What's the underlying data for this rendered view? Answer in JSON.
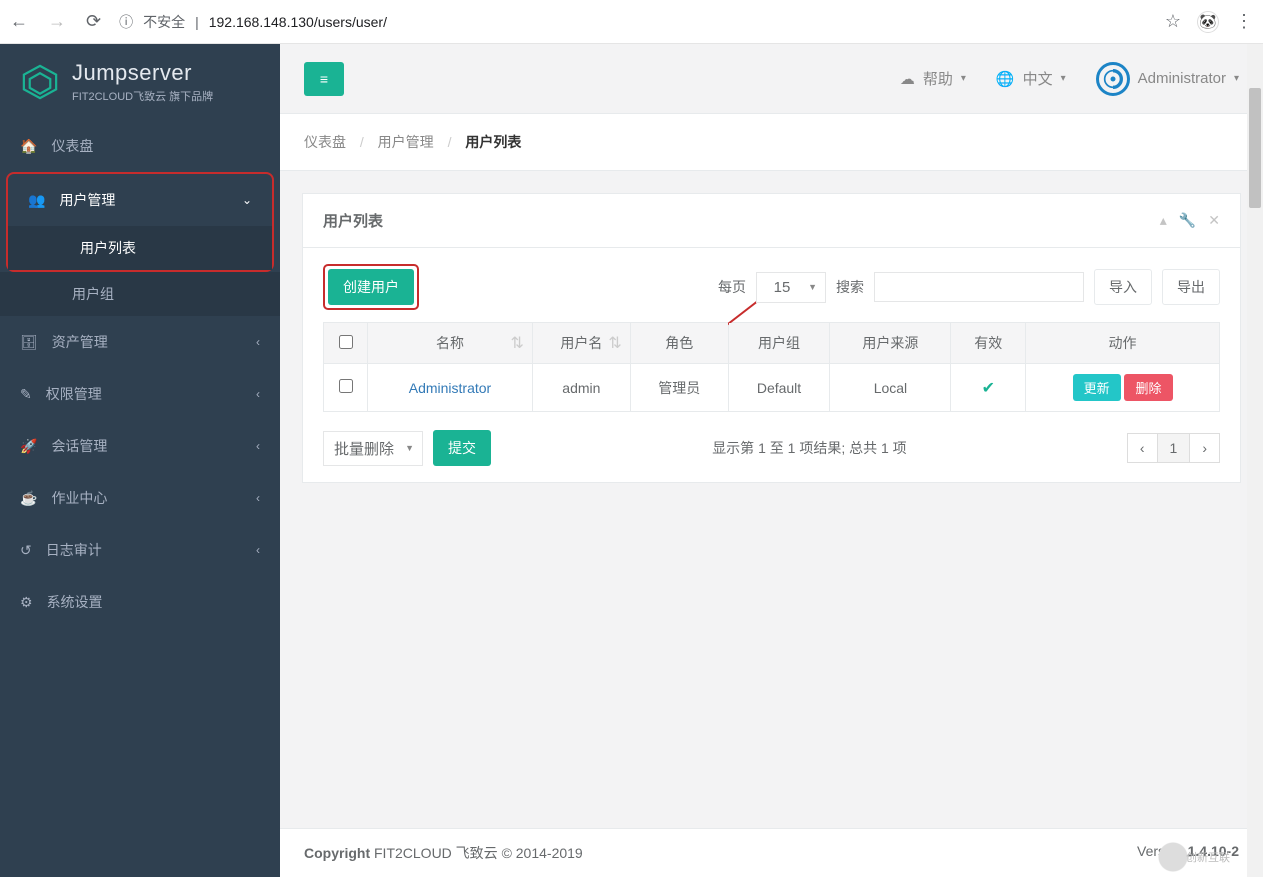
{
  "browser": {
    "security": "不安全",
    "url": "192.168.148.130/users/user/",
    "info_icon_label": "ⓘ"
  },
  "brand": {
    "title": "Jumpserver",
    "subtitle": "FIT2CLOUD飞致云 旗下品牌"
  },
  "topbar": {
    "help": "帮助",
    "lang": "中文",
    "user": "Administrator"
  },
  "breadcrumb": {
    "dashboard": "仪表盘",
    "userMgmt": "用户管理",
    "userList": "用户列表"
  },
  "sidebar": {
    "dashboard": "仪表盘",
    "userMgmt": "用户管理",
    "userList": "用户列表",
    "userGroup": "用户组",
    "assetMgmt": "资产管理",
    "permMgmt": "权限管理",
    "sessionMgmt": "会话管理",
    "jobCenter": "作业中心",
    "audit": "日志审计",
    "settings": "系统设置"
  },
  "panel": {
    "title": "用户列表",
    "create": "创建用户",
    "perPageLabel": "每页",
    "perPageValue": "15",
    "searchLabel": "搜索",
    "import": "导入",
    "export": "导出"
  },
  "table": {
    "headers": {
      "name": "名称",
      "username": "用户名",
      "role": "角色",
      "group": "用户组",
      "source": "用户来源",
      "valid": "有效",
      "action": "动作"
    },
    "rows": [
      {
        "name": "Administrator",
        "username": "admin",
        "role": "管理员",
        "group": "Default",
        "source": "Local",
        "valid": true
      }
    ],
    "actions": {
      "update": "更新",
      "delete": "删除"
    },
    "batch": {
      "delete": "批量删除",
      "submit": "提交"
    },
    "info": "显示第 1 至 1 项结果; 总共 1 项",
    "page": "1"
  },
  "footer": {
    "copyright_label": "Copyright",
    "copyright_text": " FIT2CLOUD 飞致云 © 2014-2019",
    "version_label": "Version ",
    "version_value": "1.4.10-2"
  },
  "watermark": "创新互联"
}
